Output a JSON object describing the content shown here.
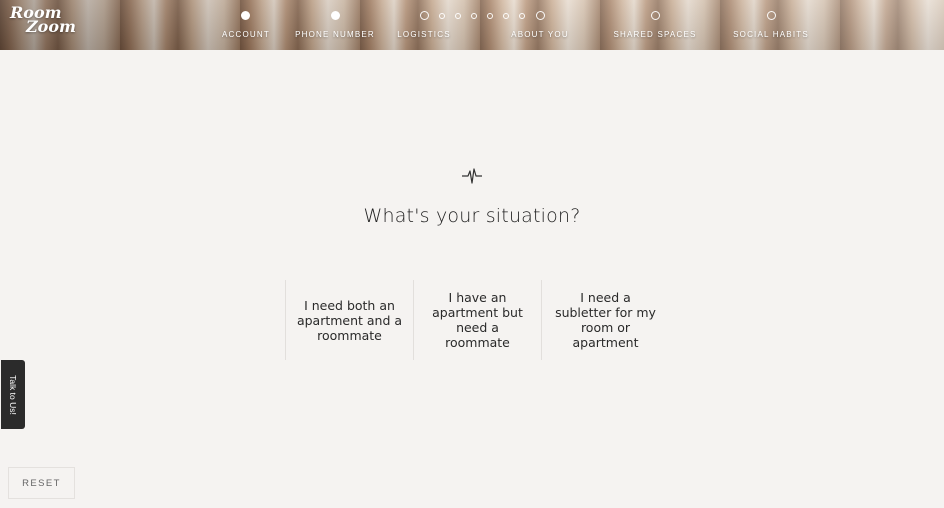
{
  "header": {
    "logo": {
      "line1": "Room",
      "line2": "Zoom"
    },
    "steps": [
      {
        "label": "ACCOUNT",
        "state": "completed"
      },
      {
        "label": "PHONE NUMBER",
        "state": "completed"
      },
      {
        "label": "LOGISTICS",
        "state": "upcoming",
        "substeps": 7
      },
      {
        "label": "ABOUT YOU",
        "state": "upcoming"
      },
      {
        "label": "SHARED SPACES",
        "state": "upcoming"
      },
      {
        "label": "SOCIAL HABITS",
        "state": "upcoming"
      }
    ]
  },
  "main": {
    "icon": "pulse-icon",
    "question": "What's your situation?",
    "options": [
      {
        "label": "I need both an apartment and a roommate"
      },
      {
        "label": "I have an apartment but need a roommate"
      },
      {
        "label": "I need a subletter for my room or apartment"
      }
    ]
  },
  "talk_tab": {
    "label": "Talk to Us!"
  },
  "reset_label": "RESET",
  "colors": {
    "background": "#f5f3f1",
    "text": "#222222",
    "tab": "#2b2b2b"
  }
}
